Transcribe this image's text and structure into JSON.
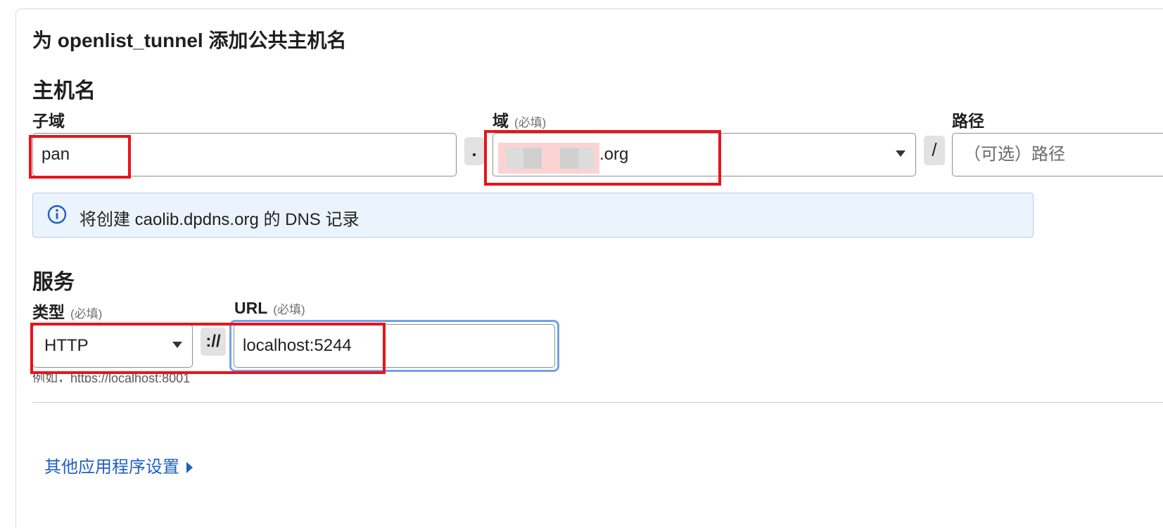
{
  "header": {
    "title": "为 openlist_tunnel 添加公共主机名"
  },
  "hostname_section": {
    "title": "主机名",
    "subdomain": {
      "label": "子域",
      "value": "pan"
    },
    "dot_separator": ".",
    "domain": {
      "label": "域",
      "required_note": "(必填)",
      "value_visible_suffix": ".org"
    },
    "slash_separator": "/",
    "path": {
      "label": "路径",
      "placeholder": "（可选）路径"
    },
    "info_banner": {
      "text": "将创建 caolib.dpdns.org 的 DNS 记录"
    }
  },
  "service_section": {
    "title": "服务",
    "type": {
      "label": "类型",
      "required_note": "(必填)",
      "value": "HTTP"
    },
    "scheme_separator": "://",
    "url": {
      "label": "URL",
      "required_note": "(必填)",
      "value": "localhost:5244"
    },
    "helper_text": "例如，https://localhost:8001"
  },
  "additional_settings": {
    "label": "其他应用程序设置"
  },
  "annotation_color": "#e8141b",
  "link_color": "#1f5fc2",
  "banner_color": "#ebf3fd"
}
